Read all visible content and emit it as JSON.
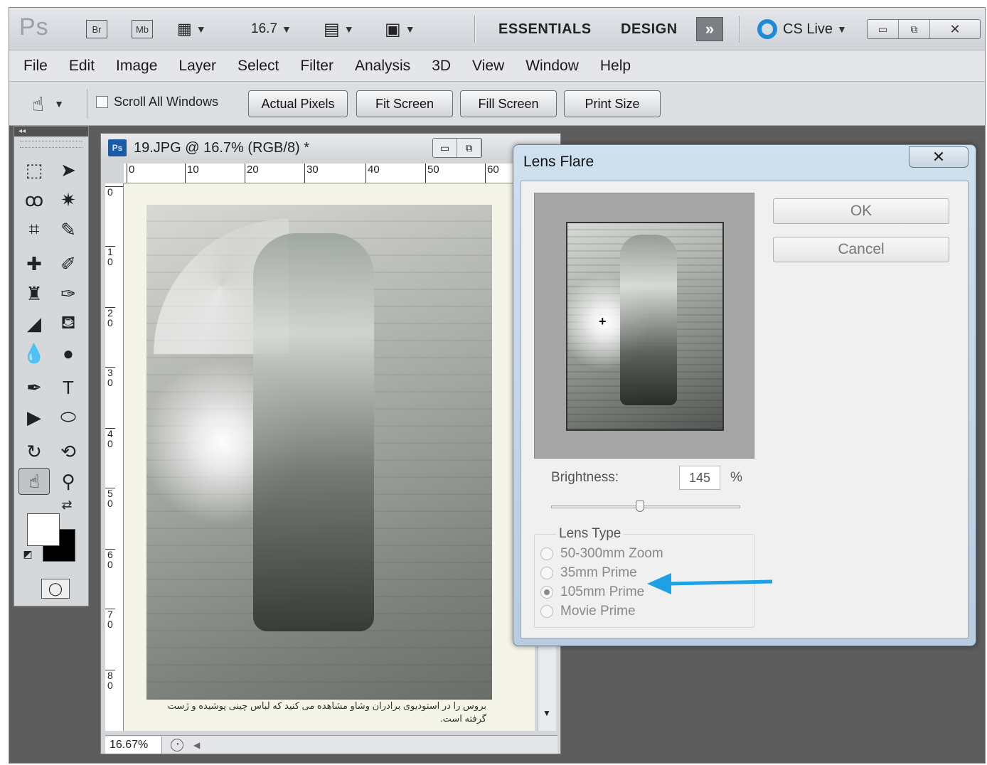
{
  "appbar": {
    "ps_logo": "Ps",
    "bridge": "Br",
    "minibridge": "Mb",
    "zoom_value": "16.7",
    "workspaces": [
      "ESSENTIALS",
      "DESIGN"
    ],
    "more_workspaces_glyph": "»",
    "cslive_label": "CS Live",
    "window_controls": [
      "▭",
      "⧉",
      "✕"
    ]
  },
  "menu": {
    "items": [
      "File",
      "Edit",
      "Image",
      "Layer",
      "Select",
      "Filter",
      "Analysis",
      "3D",
      "View",
      "Window",
      "Help"
    ]
  },
  "options": {
    "tool_icon": "hand-icon",
    "scroll_all_label": "Scroll All Windows",
    "buttons": [
      "Actual Pixels",
      "Fit Screen",
      "Fill Screen",
      "Print Size"
    ]
  },
  "tools_panel": {
    "collapse_glyph": "◂◂"
  },
  "document": {
    "title": "19.JPG @ 16.7% (RGB/8) *",
    "ps_badge": "Ps",
    "ruler_top": [
      "0",
      "10",
      "20",
      "30",
      "40",
      "50",
      "60"
    ],
    "ruler_left": [
      "0",
      "1 0",
      "2 0",
      "3 0",
      "4 0",
      "5 0",
      "6 0",
      "7 0",
      "8 0"
    ],
    "caption_line1": "بروس را در استودیوی برادران وشاو مشاهده می کنید که لباس چینی پوشیده و ژست",
    "caption_line2": "گرفته است.",
    "zoom_status": "16.67%"
  },
  "dialog": {
    "title": "Lens Flare",
    "close_glyph": "✕",
    "ok_label": "OK",
    "cancel_label": "Cancel",
    "brightness_label": "Brightness:",
    "brightness_value": "145",
    "brightness_unit": "%",
    "brightness_slider_fraction": 0.47,
    "lens_type_label": "Lens Type",
    "lens_options": [
      "50-300mm Zoom",
      "35mm Prime",
      "105mm Prime",
      "Movie Prime"
    ],
    "selected_lens": "105mm Prime",
    "crosshair_glyph": "+"
  },
  "annotation": {
    "arrow_color": "#1da1e2"
  }
}
